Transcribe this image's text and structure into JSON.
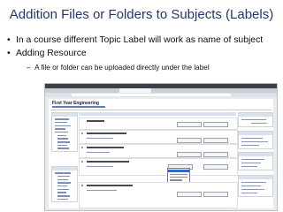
{
  "slide": {
    "title": "Addition Files or Folders to Subjects (Labels)",
    "bullets": [
      "In a course different Topic Label will work as name of subject",
      "Adding Resource"
    ],
    "sub_bullets": [
      "A file or folder can be uploaded directly under the label"
    ]
  },
  "screenshot": {
    "course_title": "First Year Engineering"
  }
}
